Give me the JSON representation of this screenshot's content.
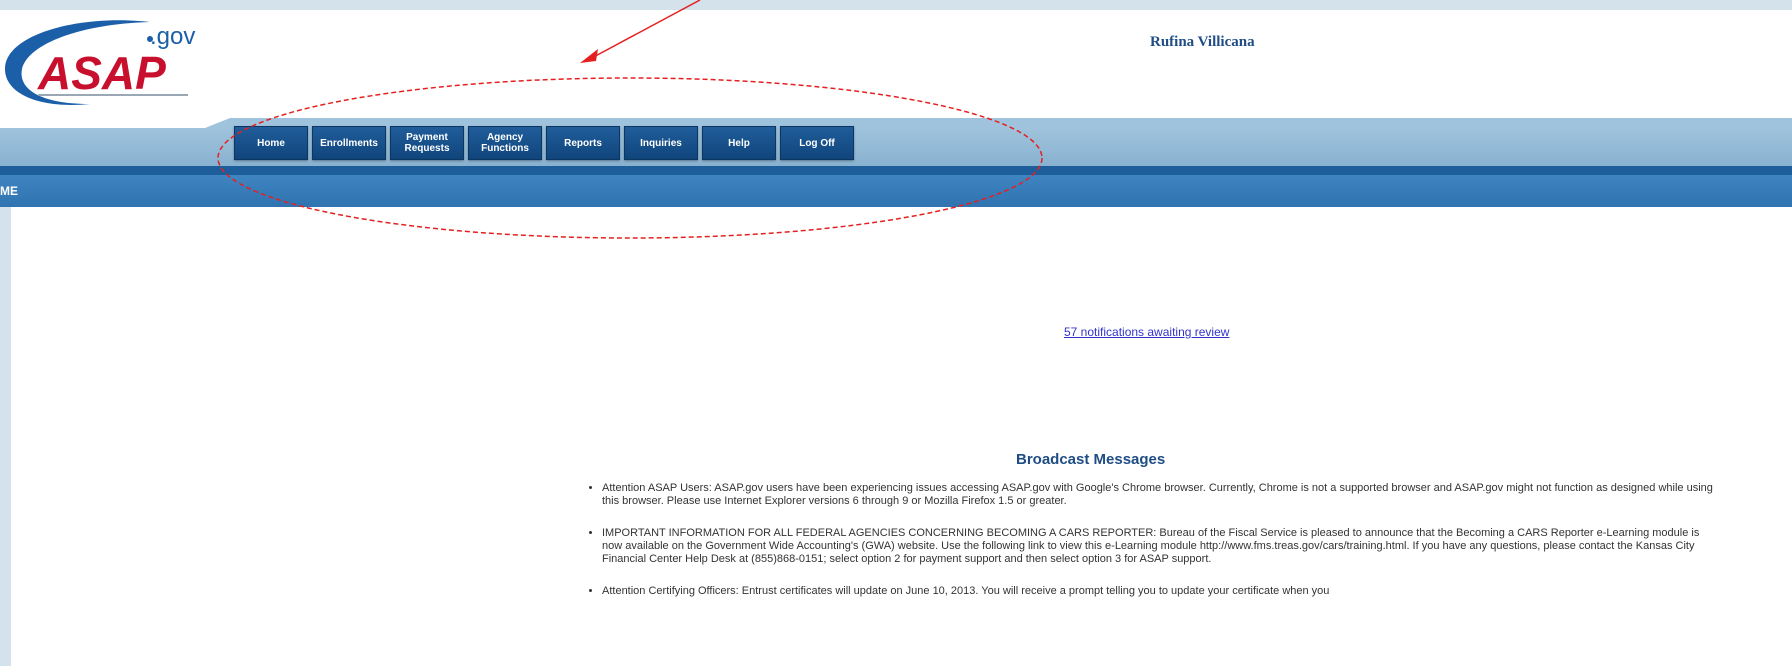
{
  "header": {
    "logo": {
      "main": "ASAP",
      "suffix": ".gov"
    },
    "user_name": "Rufina Villicana"
  },
  "nav": {
    "items": [
      {
        "label": "Home"
      },
      {
        "label": "Enrollments"
      },
      {
        "label": "Payment\nRequests"
      },
      {
        "label": "Agency\nFunctions"
      },
      {
        "label": "Reports"
      },
      {
        "label": "Inquiries"
      },
      {
        "label": "Help"
      },
      {
        "label": "Log Off"
      }
    ]
  },
  "breadcrumb": "ME",
  "notification_link": "57 notifications awaiting review",
  "broadcast": {
    "title": "Broadcast Messages",
    "messages": [
      "Attention ASAP Users: ASAP.gov users have been experiencing issues accessing ASAP.gov with Google's Chrome browser. Currently, Chrome is not a supported browser and ASAP.gov might not function as designed while using this browser. Please use Internet Explorer versions 6 through 9 or Mozilla Firefox 1.5 or greater.",
      "IMPORTANT INFORMATION FOR ALL FEDERAL AGENCIES CONCERNING BECOMING A CARS REPORTER: Bureau of the Fiscal Service is pleased to announce that the Becoming a CARS Reporter e-Learning module is now available on the Government Wide Accounting's (GWA) website. Use the following link to view this e-Learning module http://www.fms.treas.gov/cars/training.html. If you have any questions, please contact the Kansas City Financial Center Help Desk at (855)868-0151; select option 2 for payment support and then select option 3 for ASAP support.",
      "Attention Certifying Officers: Entrust certificates will update on June 10, 2013. You will receive a prompt telling you to update your certificate when you"
    ]
  },
  "colors": {
    "nav_button": "#1a5490",
    "band": "#9fc3dc",
    "bar": "#3a7fbd",
    "annotation": "#e52020"
  }
}
